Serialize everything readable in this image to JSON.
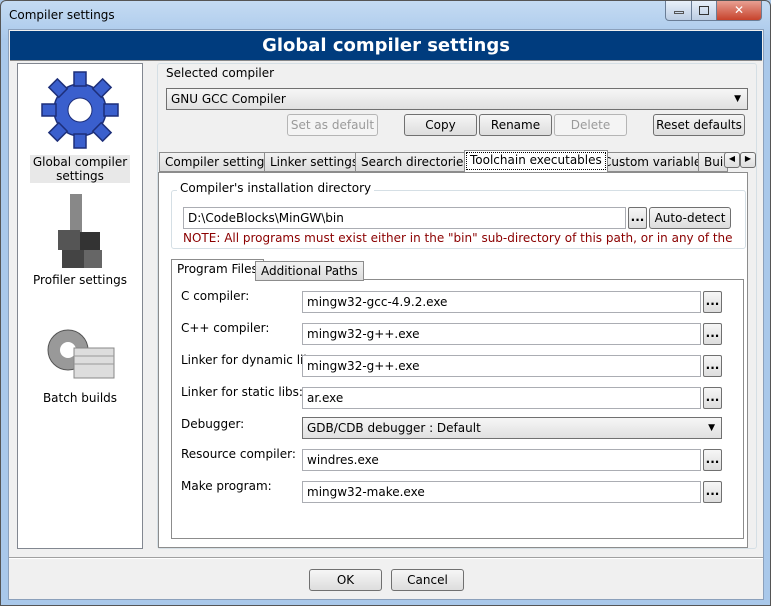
{
  "window": {
    "title": "Compiler settings"
  },
  "banner": "Global compiler settings",
  "sidebar": {
    "items": [
      {
        "label": "Global compiler settings",
        "icon": "gear-icon"
      },
      {
        "label": "Profiler settings",
        "icon": "profiler-icon"
      },
      {
        "label": "Batch builds",
        "icon": "batch-builds-icon"
      }
    ]
  },
  "selected_compiler": {
    "label": "Selected compiler",
    "value": "GNU GCC Compiler"
  },
  "buttons": {
    "set_default": "Set as default",
    "copy": "Copy",
    "rename": "Rename",
    "delete": "Delete",
    "reset": "Reset defaults",
    "ok": "OK",
    "cancel": "Cancel",
    "browse": "...",
    "autodetect": "Auto-detect"
  },
  "tabs": [
    "Compiler settings",
    "Linker settings",
    "Search directories",
    "Toolchain executables",
    "Custom variables",
    "Bui"
  ],
  "install_dir": {
    "label": "Compiler's installation directory",
    "value": "D:\\CodeBlocks\\MinGW\\bin",
    "note": "NOTE: All programs must exist either in the \"bin\" sub-directory of this path, or in any of the"
  },
  "subtabs": [
    "Program Files",
    "Additional Paths"
  ],
  "programs": [
    {
      "label": "C compiler:",
      "value": "mingw32-gcc-4.9.2.exe"
    },
    {
      "label": "C++ compiler:",
      "value": "mingw32-g++.exe"
    },
    {
      "label": "Linker for dynamic libs:",
      "value": "mingw32-g++.exe"
    },
    {
      "label": "Linker for static libs:",
      "value": "ar.exe"
    },
    {
      "label": "Debugger:",
      "value": "GDB/CDB debugger : Default"
    },
    {
      "label": "Resource compiler:",
      "value": "windres.exe"
    },
    {
      "label": "Make program:",
      "value": "mingw32-make.exe"
    }
  ],
  "colors": {
    "banner": "#003c7e",
    "note": "#8b0000"
  }
}
